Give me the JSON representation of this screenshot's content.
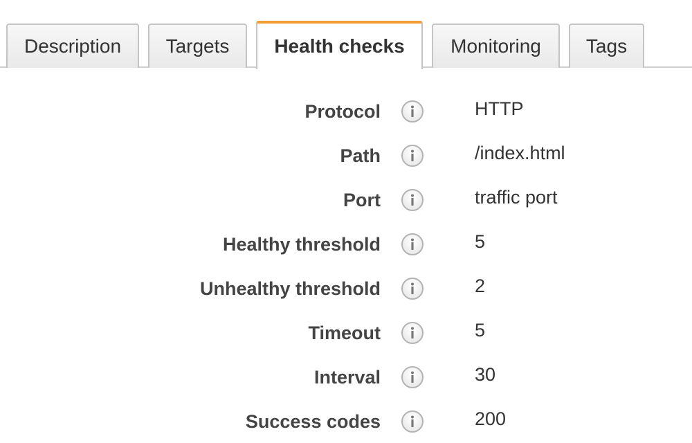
{
  "tabs": [
    {
      "label": "Description",
      "active": false
    },
    {
      "label": "Targets",
      "active": false
    },
    {
      "label": "Health checks",
      "active": true
    },
    {
      "label": "Monitoring",
      "active": false
    },
    {
      "label": "Tags",
      "active": false
    }
  ],
  "health_checks": [
    {
      "label": "Protocol",
      "value": "HTTP"
    },
    {
      "label": "Path",
      "value": "/index.html"
    },
    {
      "label": "Port",
      "value": "traffic port"
    },
    {
      "label": "Healthy threshold",
      "value": "5"
    },
    {
      "label": "Unhealthy threshold",
      "value": "2"
    },
    {
      "label": "Timeout",
      "value": "5"
    },
    {
      "label": "Interval",
      "value": "30"
    },
    {
      "label": "Success codes",
      "value": "200"
    }
  ],
  "colors": {
    "active_tab_accent": "#f39c33",
    "label_text": "#444444",
    "value_text": "#333333"
  },
  "icons": {
    "info": "info-icon"
  }
}
